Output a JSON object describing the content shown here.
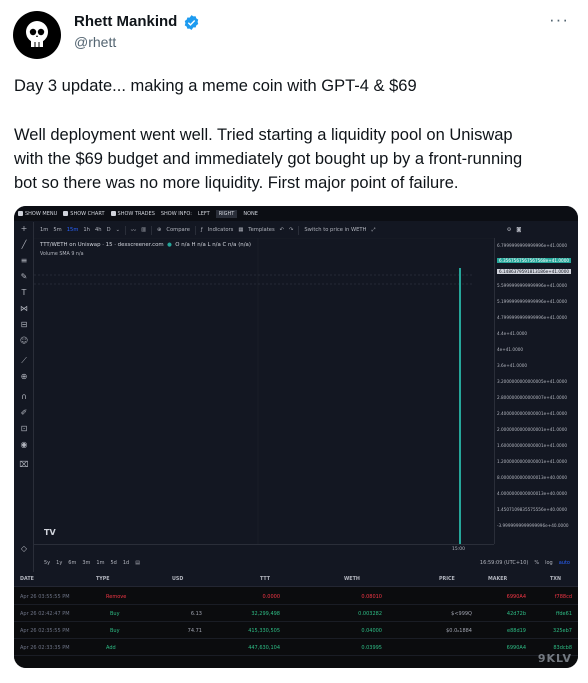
{
  "tweet": {
    "name": "Rhett Mankind",
    "handle": "@rhett",
    "more": "···",
    "line1": "Day 3 update... making a meme coin with GPT-4 & $69",
    "line2": "Well deployment went well. Tried starting a liquidity pool on Uniswap",
    "line3": "with the $69 budget and immediately got bought up by a front-running",
    "line4": "bot so there was no more liquidity. First major point of failure.",
    "verified_color": "#1d9bf0"
  },
  "screenshot": {
    "topbar": {
      "show_menu": "SHOW MENU",
      "show_chart": "SHOW CHART",
      "show_trades": "SHOW TRADES",
      "show_info": "SHOW INFO:",
      "left": "LEFT",
      "right": "RIGHT",
      "none": "NONE"
    },
    "toolbar": {
      "timeframes": [
        "1m",
        "5m",
        "15m",
        "1h",
        "4h",
        "D"
      ],
      "compare": "Compare",
      "indicators": "Indicators",
      "templates": "Templates",
      "switch": "Switch to price in WETH"
    },
    "legend": {
      "pair": "TTT/WETH on Uniswap · 15 · dexscreener.com",
      "ohlc": "O n/a H n/a L n/a C n/a (n/a)",
      "volume": "Volume  SMA 9  n/a"
    },
    "price_axis": [
      "6.7999999999999996e+41.0000",
      "6.3567567567567568e+41.0000",
      "6.1486379591813186e+41.0000",
      "5.5999999999999996e+41.0000",
      "5.1999999999999996e+41.0000",
      "4.7999999999999996e+41.0000",
      "4.4e+41.0000",
      "4e+41.0000",
      "3.6e+41.0000",
      "3.2000000000000005e+41.0000",
      "2.8000000000000007e+41.0000",
      "2.4000000000000001e+41.0000",
      "2.0000000000000001e+41.0000",
      "1.6000000000000001e+41.0000",
      "1.2000000000000001e+41.0000",
      "8.0000000000000013e+40.0000",
      "4.0000000000000013e+40.0000",
      "1.4507109835575556e+40.0000",
      "-3.9999999999999996e+40.0000"
    ],
    "time_axis": {
      "label": "15:00"
    },
    "bottom": {
      "ranges": [
        "5y",
        "1y",
        "6m",
        "3m",
        "1m",
        "5d",
        "1d"
      ],
      "clock": "16:59:09 (UTC+10)",
      "pct": "%",
      "log": "log",
      "auto": "auto"
    },
    "table": {
      "headers": {
        "date": "DATE",
        "type": "TYPE",
        "usd": "USD",
        "ttt": "TTT",
        "weth": "WETH",
        "price": "PRICE",
        "maker": "MAKER",
        "txn": "TXN"
      },
      "rows": [
        {
          "date": "Apr 26 03:55:55 PM",
          "type": "Remove",
          "usd": "",
          "ttt": "0.0000",
          "weth": "0.08010",
          "price": "",
          "maker": "6990A4",
          "txn": "f788cd",
          "kind": "red"
        },
        {
          "date": "Apr 26 02:42:47 PM",
          "type": "Buy",
          "usd": "6.13",
          "ttt": "32,299,498",
          "weth": "0.003282",
          "price": "$<999Q",
          "maker": "42d72b",
          "txn": "ffde61",
          "kind": "green"
        },
        {
          "date": "Apr 26 02:35:55 PM",
          "type": "Buy",
          "usd": "74.71",
          "ttt": "415,330,505",
          "weth": "0.04000",
          "price": "$0.0₆1884",
          "maker": "e88d19",
          "txn": "325eb7",
          "kind": "green"
        },
        {
          "date": "Apr 26 02:33:35 PM",
          "type": "Add",
          "usd": "",
          "ttt": "447,630,104",
          "weth": "0.03995",
          "price": "",
          "maker": "6990A4",
          "txn": "83dcb8",
          "kind": "green"
        }
      ]
    },
    "watermark": "9KLV"
  }
}
